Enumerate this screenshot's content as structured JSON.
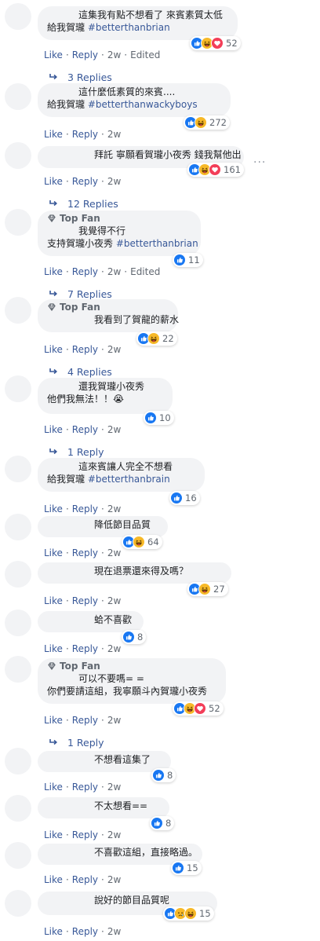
{
  "actions": {
    "like": "Like",
    "reply": "Reply",
    "edited": "Edited",
    "dot": "·"
  },
  "badge": {
    "top_fan": "Top Fan"
  },
  "more_label": "···",
  "comments": [
    {
      "lines": [
        "這集我有點不想看了 來賓素質太低",
        "給我賀瓏 #betterthanbrian"
      ],
      "tag_line": 1,
      "tag_start": 5,
      "reactions": "52",
      "icons": [
        "like",
        "haha",
        "love"
      ],
      "time": "2w",
      "edited": true,
      "replies": "3 Replies"
    },
    {
      "lines": [
        "這什麼低素質的來賓....",
        "給我賀瓏 #betterthanwackyboys"
      ],
      "tag_line": 1,
      "reactions": "272",
      "icons": [
        "like",
        "haha"
      ],
      "time": "2w",
      "edited": false
    },
    {
      "lines": [
        "拜託 寧願看賀瓏小夜秀 錢我幫他出"
      ],
      "reactions": "161",
      "icons": [
        "like",
        "haha",
        "love"
      ],
      "time": "2w",
      "edited": false,
      "replies": "12 Replies"
    },
    {
      "top_fan": true,
      "lines": [
        "我覺得不行",
        "支持賀瓏小夜秀 #betterthanbrian"
      ],
      "tag_line": 1,
      "reactions": "11",
      "icons": [
        "like"
      ],
      "time": "2w",
      "edited": true,
      "replies": "7 Replies"
    },
    {
      "top_fan": true,
      "lines": [
        "我看到了賀龍的薪水"
      ],
      "reactions": "22",
      "icons": [
        "like",
        "haha"
      ],
      "time": "2w",
      "edited": false,
      "replies": "4 Replies"
    },
    {
      "lines": [
        "還我賀瓏小夜秀",
        "他們我無法！！😭"
      ],
      "reactions": "10",
      "icons": [
        "like"
      ],
      "time": "2w",
      "edited": false,
      "replies": "1 Reply"
    },
    {
      "lines": [
        "這來賓讓人完全不想看",
        "給我賀瓏 #betterthanbrain"
      ],
      "tag_line": 1,
      "reactions": "16",
      "icons": [
        "like"
      ],
      "time": "2w",
      "edited": false
    },
    {
      "lines": [
        "降低節目品質"
      ],
      "reactions": "64",
      "icons": [
        "like",
        "haha"
      ],
      "time": "2w",
      "edited": false
    },
    {
      "lines": [
        "現在退票還來得及嗎？"
      ],
      "reactions": "27",
      "icons": [
        "like",
        "haha"
      ],
      "time": "2w",
      "edited": false
    },
    {
      "lines": [
        "蛤不喜歡"
      ],
      "reactions": "8",
      "icons": [
        "like"
      ],
      "time": "2w",
      "edited": false
    },
    {
      "top_fan": true,
      "lines": [
        "可以不要嗎= =",
        "你們要請這組，我寧願斗內賀瓏小夜秀"
      ],
      "reactions": "52",
      "icons": [
        "like",
        "haha",
        "love"
      ],
      "time": "2w",
      "edited": false,
      "replies": "1 Reply"
    },
    {
      "lines": [
        "不想看這集了"
      ],
      "reactions": "8",
      "icons": [
        "like"
      ],
      "time": "2w",
      "edited": false
    },
    {
      "lines": [
        "不太想看=="
      ],
      "reactions": "8",
      "icons": [
        "like"
      ],
      "time": "2w",
      "edited": false
    },
    {
      "lines": [
        "不喜歡這組，直接略過。"
      ],
      "reactions": "15",
      "icons": [
        "like"
      ],
      "time": "2w",
      "edited": false
    },
    {
      "lines": [
        "說好的節目品質呢"
      ],
      "reactions": "15",
      "icons": [
        "like",
        "sad",
        "haha"
      ],
      "time": "2w",
      "edited": false
    }
  ],
  "colors": {
    "link": "#385898",
    "bubble": "#f2f3f5",
    "like": "#1877f2",
    "haha": "#f7b928",
    "love": "#f33e58"
  }
}
